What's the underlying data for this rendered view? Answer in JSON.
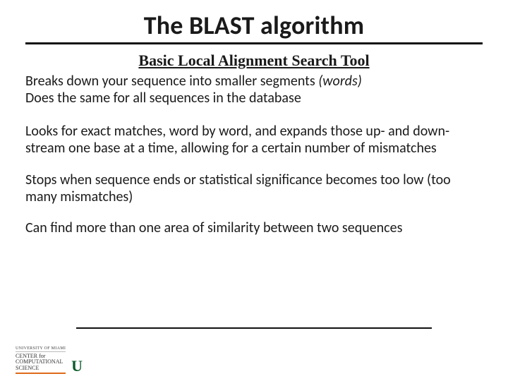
{
  "title": "The BLAST algorithm",
  "subtitle": "Basic Local Alignment Search Tool",
  "lines": {
    "l1": "Breaks down your sequence into smaller segments ",
    "l1_italic": "(words)",
    "l2": "Does the same for all sequences in the database",
    "p2": "Looks for exact matches, word by word, and expands those up- and down- stream one base at a time, allowing for a certain number of mismatches",
    "p3": "Stops when sequence ends or statistical significance becomes too low (too many mismatches)",
    "p4": "Can find more than one area of similarity between two sequences"
  },
  "footer": {
    "university": "UNIVERSITY OF MIAMI",
    "center_l1": "CENTER for",
    "center_l2": "COMPUTATIONAL",
    "center_l3": "SCIENCE",
    "u_glyph": "U"
  }
}
